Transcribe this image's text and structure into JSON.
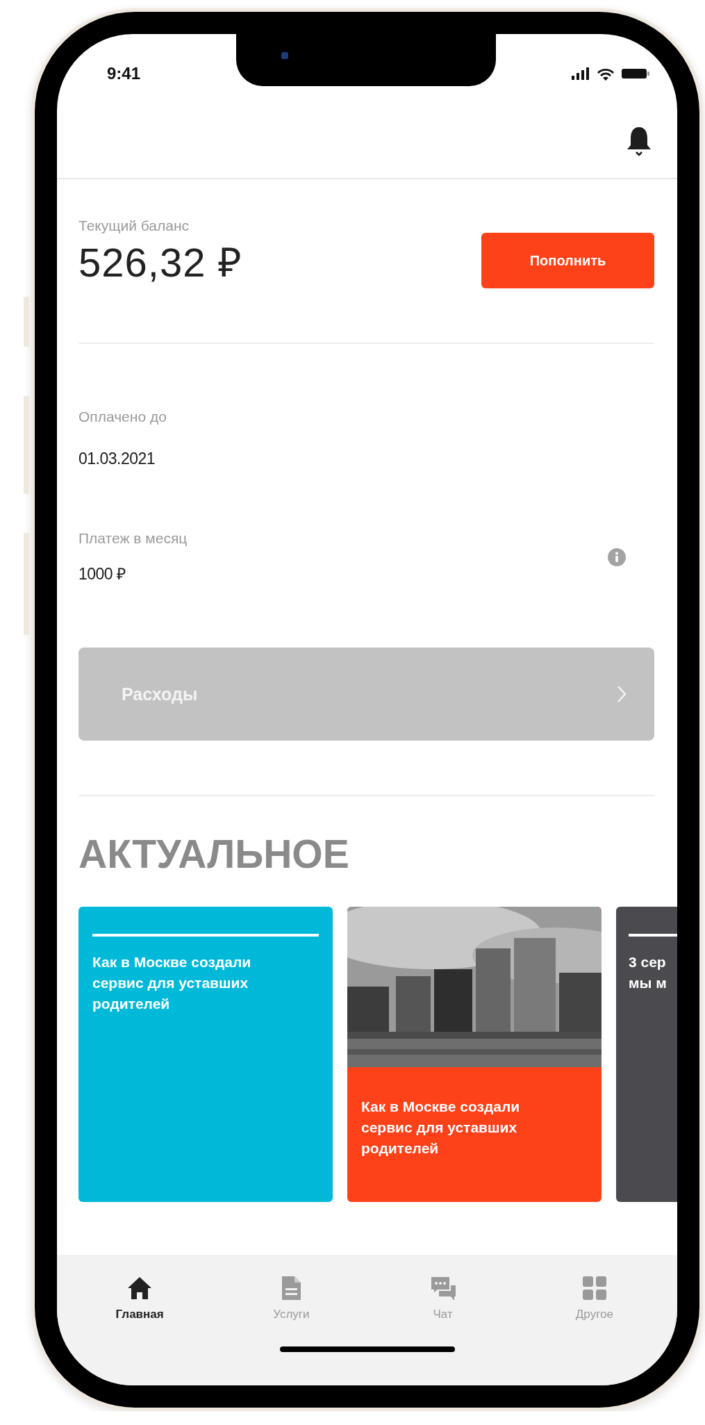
{
  "status_bar": {
    "time": "9:41"
  },
  "balance": {
    "label": "Текущий баланс",
    "amount": "526,32 ₽",
    "button": "Пополнить"
  },
  "paid_until": {
    "label": "Оплачено до",
    "value": "01.03.2021"
  },
  "monthly_payment": {
    "label": "Платеж в месяц",
    "value": "1000 ₽"
  },
  "expenses": {
    "label": "Расходы"
  },
  "news": {
    "title": "АКТУАЛЬНОЕ",
    "cards": [
      {
        "kind": "plain",
        "color": "#00b9d9",
        "title": "Как в Москве создали сервис для уставших родителей"
      },
      {
        "kind": "picture",
        "color": "#fd4119",
        "title": "Как в Москве создали сервис для уставших родителей"
      },
      {
        "kind": "plain",
        "color": "#4b4b4f",
        "title": "3 сер\nмы м"
      }
    ]
  },
  "tab_bar": {
    "tabs": [
      {
        "label": "Главная",
        "selected": true
      },
      {
        "label": "Услуги",
        "selected": false
      },
      {
        "label": "Чат",
        "selected": false
      },
      {
        "label": "Другое",
        "selected": false
      }
    ]
  }
}
